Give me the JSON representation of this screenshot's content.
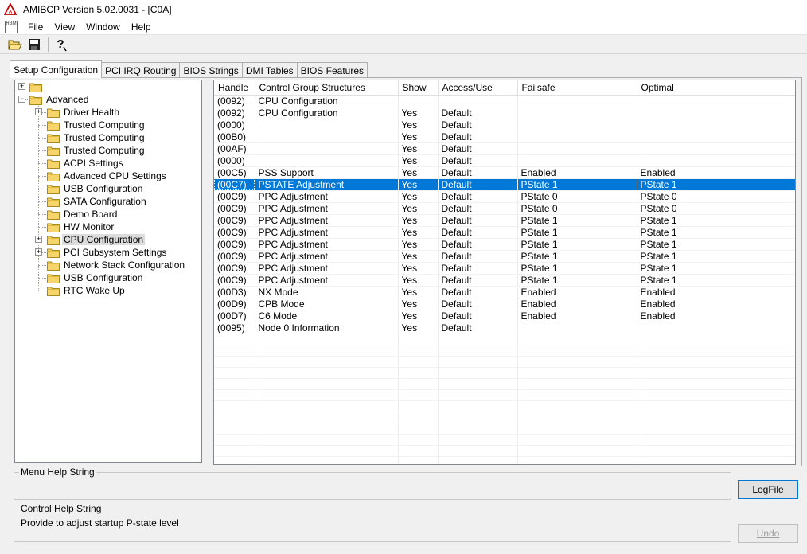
{
  "window": {
    "title": "AMIBCP Version 5.02.0031 - [C0A]"
  },
  "menubar": {
    "sys_icon_text": "RBM",
    "items": [
      "File",
      "View",
      "Window",
      "Help"
    ]
  },
  "toolbar": {
    "buttons": [
      "open-folder-icon",
      "save-disk-icon",
      "help-icon"
    ]
  },
  "tabs": [
    "Setup Configuration",
    "PCI IRQ Routing",
    "BIOS Strings",
    "DMI Tables",
    "BIOS Features"
  ],
  "active_tab": "Setup Configuration",
  "tree": {
    "root_label": "",
    "advanced_label": "Advanced",
    "children": [
      "Driver Health",
      "Trusted Computing",
      "Trusted Computing",
      "Trusted Computing",
      "ACPI Settings",
      "Advanced CPU Settings",
      "USB Configuration",
      "SATA Configuration",
      "Demo Board",
      "HW Monitor",
      "CPU Configuration",
      "PCI Subsystem Settings",
      "Network Stack Configuration",
      "USB Configuration",
      "RTC Wake Up"
    ],
    "selected": "CPU Configuration"
  },
  "grid": {
    "columns": [
      "Handle",
      "Control Group Structures",
      "Show",
      "Access/Use",
      "Failsafe",
      "Optimal"
    ],
    "rows": [
      [
        "(0092)",
        "CPU Configuration",
        "",
        "",
        "",
        ""
      ],
      [
        "(0092)",
        "CPU Configuration",
        "Yes",
        "Default",
        "",
        ""
      ],
      [
        "(0000)",
        "",
        "Yes",
        "Default",
        "",
        ""
      ],
      [
        "(00B0)",
        "",
        "Yes",
        "Default",
        "",
        ""
      ],
      [
        "(00AF)",
        "",
        "Yes",
        "Default",
        "",
        ""
      ],
      [
        "(0000)",
        "",
        "Yes",
        "Default",
        "",
        ""
      ],
      [
        "(00C5)",
        "PSS Support",
        "Yes",
        "Default",
        "Enabled",
        "Enabled"
      ],
      [
        "(00C7)",
        "PSTATE Adjustment",
        "Yes",
        "Default",
        "PState 1",
        "PState 1"
      ],
      [
        "(00C9)",
        "PPC Adjustment",
        "Yes",
        "Default",
        "PState 0",
        "PState 0"
      ],
      [
        "(00C9)",
        "PPC Adjustment",
        "Yes",
        "Default",
        "PState 0",
        "PState 0"
      ],
      [
        "(00C9)",
        "PPC Adjustment",
        "Yes",
        "Default",
        "PState 1",
        "PState 1"
      ],
      [
        "(00C9)",
        "PPC Adjustment",
        "Yes",
        "Default",
        "PState 1",
        "PState 1"
      ],
      [
        "(00C9)",
        "PPC Adjustment",
        "Yes",
        "Default",
        "PState 1",
        "PState 1"
      ],
      [
        "(00C9)",
        "PPC Adjustment",
        "Yes",
        "Default",
        "PState 1",
        "PState 1"
      ],
      [
        "(00C9)",
        "PPC Adjustment",
        "Yes",
        "Default",
        "PState 1",
        "PState 1"
      ],
      [
        "(00C9)",
        "PPC Adjustment",
        "Yes",
        "Default",
        "PState 1",
        "PState 1"
      ],
      [
        "(00D3)",
        "NX Mode",
        "Yes",
        "Default",
        "Enabled",
        "Enabled"
      ],
      [
        "(00D9)",
        "CPB Mode",
        "Yes",
        "Default",
        "Enabled",
        "Enabled"
      ],
      [
        "(00D7)",
        "C6 Mode",
        "Yes",
        "Default",
        "Enabled",
        "Enabled"
      ],
      [
        "(0095)",
        "Node 0 Information",
        "Yes",
        "Default",
        "",
        ""
      ]
    ],
    "selected_row": 7,
    "total_rows": 33
  },
  "menu_help": {
    "label": "Menu Help String",
    "text": ""
  },
  "control_help": {
    "label": "Control Help String",
    "text": "Provide to adjust startup P-state level"
  },
  "buttons": {
    "logfile": "LogFile",
    "undo": "Undo"
  },
  "colors": {
    "selection": "#0078d7",
    "window_bg": "#f0f0f0",
    "folder": "#f5d56a"
  }
}
